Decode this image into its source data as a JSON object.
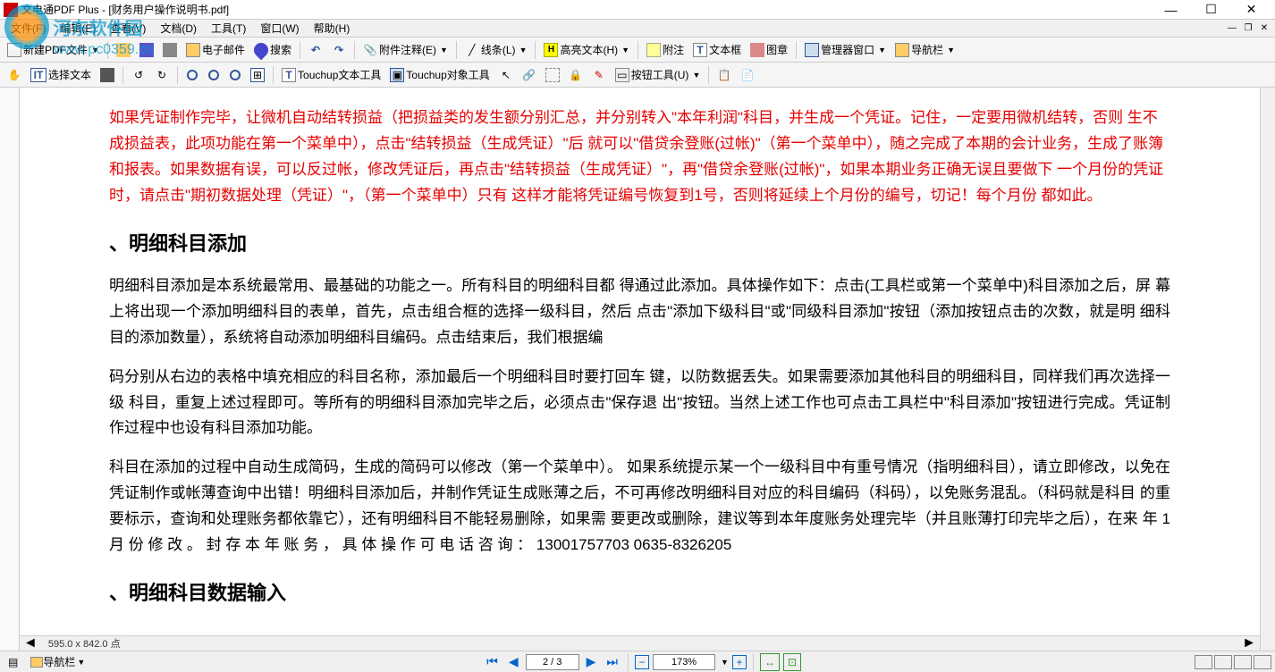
{
  "titlebar": {
    "title": "文电通PDF Plus - [财务用户操作说明书.pdf]"
  },
  "menubar": {
    "items": [
      "文件(F)",
      "编辑(E)",
      "查看(V)",
      "文档(D)",
      "工具(T)",
      "窗口(W)",
      "帮助(H)"
    ]
  },
  "toolbar1": {
    "new_pdf": "新建PDF文件",
    "email": "电子邮件",
    "search": "搜索",
    "attach_annot": "附件注释(E)",
    "lines": "线条(L)",
    "highlight": "高亮文本(H)",
    "attach": "附注",
    "textbox": "文本框",
    "stamp": "图章",
    "manager_window": "管理器窗口",
    "navbar": "导航栏"
  },
  "toolbar2": {
    "select_text": "选择文本",
    "touchup_text": "Touchup文本工具",
    "touchup_obj": "Touchup对象工具",
    "button_tool": "按钮工具(U)"
  },
  "document": {
    "red_para": "如果凭证制作完毕，让微机自动结转损益（把损益类的发生额分别汇总，并分别转入\"本年利润\"科目，并生成一个凭证。记住，一定要用微机结转，否则 生不成损益表，此项功能在第一个菜单中），点击\"结转损益（生成凭证）\"后 就可以\"借贷余登账(过帐)\"（第一个菜单中），随之完成了本期的会计业务，生成了账簿和报表。如果数据有误，可以反过帐，修改凭证后，再点击\"结转损益（生成凭证）\"，再\"借贷余登账(过帐)\"，如果本期业务正确无误且要做下 一个月份的凭证时，请点击\"期初数据处理（凭证）\"，（第一个菜单中）只有 这样才能将凭证编号恢复到1号，否则将延续上个月份的编号，切记！每个月份 都如此。",
    "heading1": "、明细科目添加",
    "para1": "明细科目添加是本系统最常用、最基础的功能之一。所有科目的明细科目都 得通过此添加。具体操作如下：点击(工具栏或第一个菜单中)科目添加之后，屏 幕上将出现一个添加明细科目的表单，首先，点击组合框的选择一级科目，然后 点击\"添加下级科目\"或\"同级科目添加\"按钮（添加按钮点击的次数，就是明 细科目的添加数量），系统将自动添加明细科目编码。点击结束后，我们根据编",
    "para2": "码分别从右边的表格中填充相应的科目名称，添加最后一个明细科目时要打回车 键，以防数据丢失。如果需要添加其他科目的明细科目，同样我们再次选择一级 科目，重复上述过程即可。等所有的明细科目添加完毕之后，必须点击\"保存退 出\"按钮。当然上述工作也可点击工具栏中\"科目添加\"按钮进行完成。凭证制 作过程中也设有科目添加功能。",
    "para3": "科目在添加的过程中自动生成简码，生成的简码可以修改（第一个菜单中）。 如果系统提示某一个一级科目中有重号情况（指明细科目），请立即修改，以免在凭证制作或帐薄查询中出错！明细科目添加后，并制作凭证生成账薄之后，不可再修改明细科目对应的科目编码（科码），以免账务混乱。（科码就是科目 的重要标示，查询和处理账务都依靠它），还有明细科目不能轻易删除，如果需 要更改或删除，建议等到本年度账务处理完毕（并且账薄打印完毕之后），在来 年 1 月 份 修 改 。 封 存 本 年 账 务 ， 具 体 操 作 可 电 话 咨 询 ： 13001757703 0635-8326205",
    "heading2": "、明细科目数据输入"
  },
  "statusbar": {
    "navbar": "导航栏",
    "page": "2 / 3",
    "zoom": "173%",
    "page_size": "595.0 x 842.0 点"
  },
  "watermark": {
    "text": "河东软件园",
    "url": "www.pc0359.cn"
  }
}
